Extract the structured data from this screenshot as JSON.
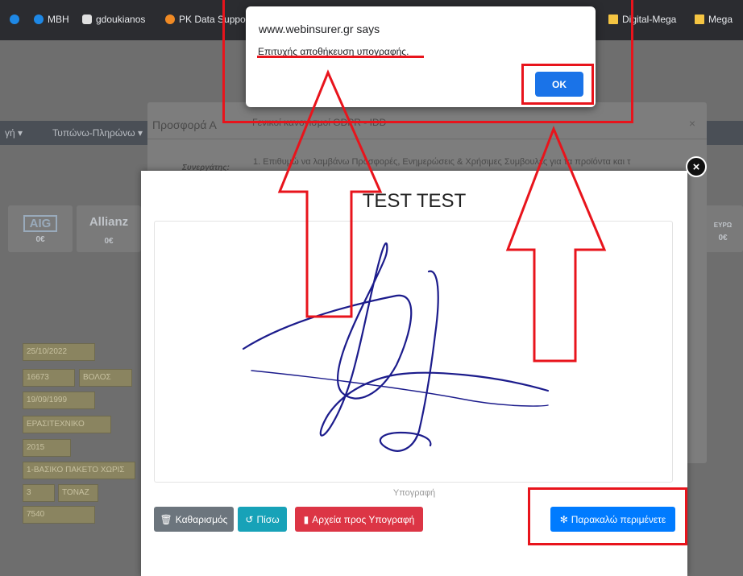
{
  "bookmarks": [
    {
      "label": "MBH",
      "color": "#1e88e5"
    },
    {
      "label": "gdoukianos",
      "color": "#e0e0e0"
    },
    {
      "label": "PK Data Suppo",
      "color": "#f08a24"
    },
    {
      "label": "Digital-Mega",
      "color": "#f5c542"
    },
    {
      "label": "Mega",
      "color": "#f5c542"
    }
  ],
  "background": {
    "nav_items": [
      "γή ▾",
      "Τυπώνω-Πληρώνω ▾"
    ],
    "insurers": [
      {
        "name": "AIG",
        "price": "0€"
      },
      {
        "name": "Allianz",
        "price": "0€"
      },
      {
        "name": "ΕΥΡΩ",
        "price": "0€"
      }
    ],
    "fields": [
      "25/10/2022",
      "16673",
      "ΒΟΛΟΣ",
      "19/09/1999",
      "ΕΡΑΣΙΤΕΧΝΙΚΟ",
      "2015",
      "1-ΒΑΣΙΚΟ ΠΑΚΕΤΟ ΧΩΡΙΣ",
      "3",
      "ΤΟΝΑΖ",
      "7540"
    ],
    "modal_title": "Προσφορά Α",
    "modal_tab": "Γενικοί κανονισμοί GDPR - IDD",
    "modal_text": "1. Επιθυμώ να λαμβάνω Προσφορές, Ενημερώσεις & Χρήσιμες Συμβουλές για τα προϊόντα και τ",
    "modal_sublabel": "Συνεργάτης:",
    "modal_close": "×"
  },
  "signature_modal": {
    "title": "TEST TEST",
    "canvas_label": "Υπογραφή",
    "close": "×",
    "buttons": {
      "clear": "Καθαρισμός",
      "back": "Πίσω",
      "files": "Αρχεία προς Υπογραφή",
      "wait": "Παρακαλώ περιμένετε"
    },
    "button_colors": {
      "clear": "#6c757d",
      "back": "#17a2b8",
      "files": "#dc3545",
      "wait": "#007bff"
    }
  },
  "alert": {
    "site": "www.webinsurer.gr says",
    "message": "Επιτυχής αποθήκευση υπογραφής.",
    "ok": "OK"
  },
  "annotation_color": "#e8141c"
}
